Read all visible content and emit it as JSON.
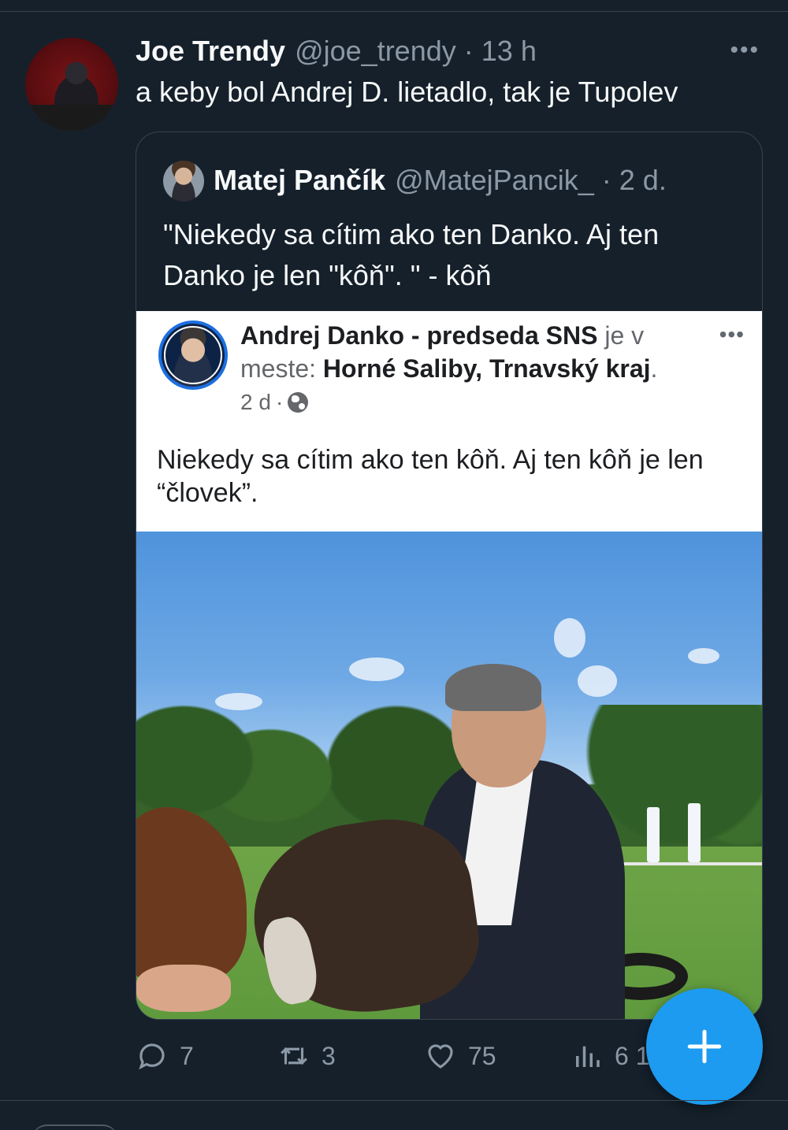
{
  "tweet": {
    "author_name": "Joe Trendy",
    "author_handle": "@joe_trendy",
    "separator": "·",
    "time": "13 h",
    "text": "a keby bol Andrej D. lietadlo, tak je Tupolev",
    "more_label": "•••"
  },
  "quoted_tweet": {
    "author_name": "Matej Pančík",
    "author_handle": "@MatejPancik_",
    "separator": "·",
    "time": "2 d.",
    "text": "\"Niekedy sa cítim ako ten Danko. Aj ten Danko je len \"kôň\". \" - kôň"
  },
  "facebook_post": {
    "page_name": "Andrej Danko - predseda SNS",
    "location_prefix": "je v meste:",
    "location": "Horné Saliby, Trnavský kraj",
    "location_suffix": ".",
    "time": "2 d",
    "separator": "·",
    "privacy_icon": "globe-icon",
    "text": "Niekedy sa cítim ako ten kôň. Aj ten kôň je len “človek”.",
    "more_label": "•••"
  },
  "actions": {
    "reply": {
      "icon": "reply-icon",
      "count": "7"
    },
    "retweet": {
      "icon": "retweet-icon",
      "count": "3"
    },
    "like": {
      "icon": "heart-icon",
      "count": "75"
    },
    "views": {
      "icon": "views-icon",
      "count": "6 1"
    }
  },
  "fab": {
    "icon": "plus-icon"
  },
  "colors": {
    "background": "#15202b",
    "border": "#38444d",
    "secondary_text": "#8b98a5",
    "accent": "#1d9bf0"
  }
}
